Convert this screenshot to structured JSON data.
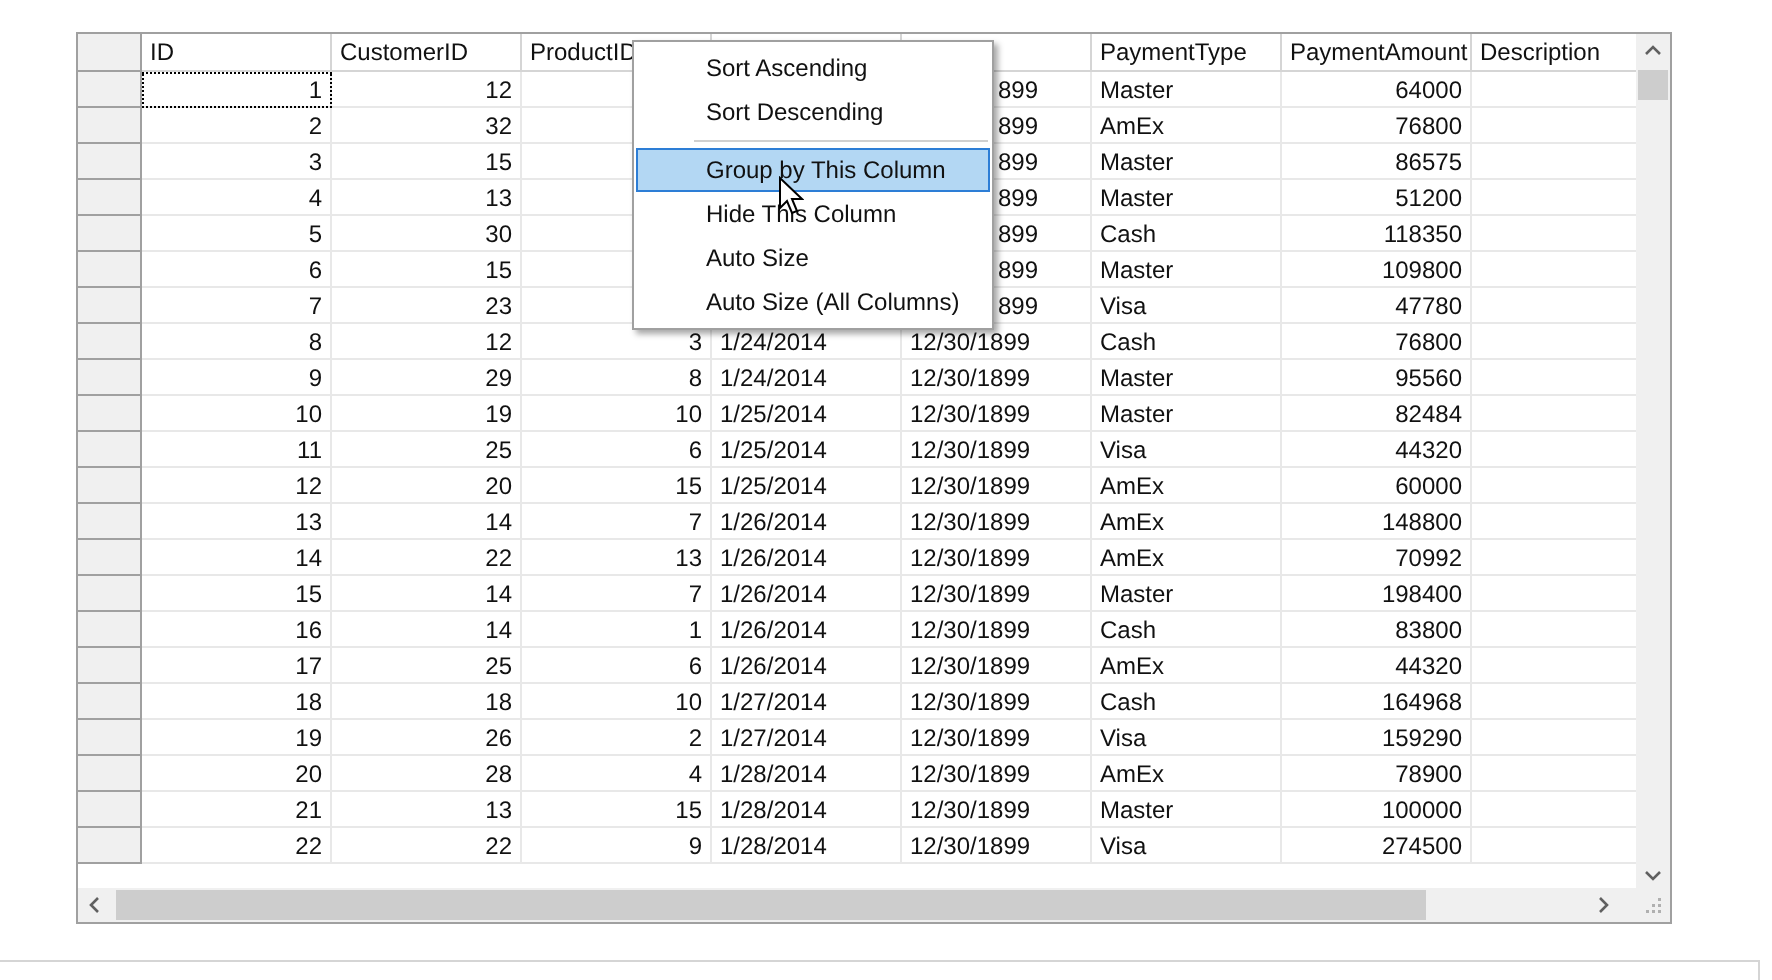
{
  "grid": {
    "columns": [
      {
        "label": "ID"
      },
      {
        "label": "CustomerID"
      },
      {
        "label": "ProductID"
      },
      {},
      {},
      {
        "label": "PaymentType"
      },
      {
        "label": "PaymentAmount"
      },
      {
        "label": "Description"
      }
    ],
    "rows": [
      {
        "focused": true,
        "cells": [
          "1",
          "12",
          null,
          null,
          {
            "kind": "cut",
            "text": "899"
          },
          "Master",
          "64000",
          null
        ]
      },
      {
        "focused": false,
        "cells": [
          "2",
          "32",
          null,
          null,
          {
            "kind": "cut",
            "text": "899"
          },
          "AmEx",
          "76800",
          null
        ]
      },
      {
        "focused": false,
        "cells": [
          "3",
          "15",
          null,
          null,
          {
            "kind": "cut",
            "text": "899"
          },
          "Master",
          "86575",
          null
        ]
      },
      {
        "focused": false,
        "cells": [
          "4",
          "13",
          null,
          null,
          {
            "kind": "cut",
            "text": "899"
          },
          "Master",
          "51200",
          null
        ]
      },
      {
        "focused": false,
        "cells": [
          "5",
          "30",
          null,
          null,
          {
            "kind": "cut",
            "text": "899"
          },
          "Cash",
          "118350",
          null
        ]
      },
      {
        "focused": false,
        "cells": [
          "6",
          "15",
          null,
          null,
          {
            "kind": "cut",
            "text": "899"
          },
          "Master",
          "109800",
          null
        ]
      },
      {
        "focused": false,
        "cells": [
          "7",
          "23",
          null,
          null,
          {
            "kind": "cut",
            "text": "899"
          },
          "Visa",
          "47780",
          null
        ]
      },
      {
        "focused": false,
        "cells": [
          "8",
          "12",
          "3",
          "1/24/2014",
          "12/30/1899",
          "Cash",
          "76800",
          null
        ]
      },
      {
        "focused": false,
        "cells": [
          "9",
          "29",
          "8",
          "1/24/2014",
          "12/30/1899",
          "Master",
          "95560",
          null
        ]
      },
      {
        "focused": false,
        "cells": [
          "10",
          "19",
          "10",
          "1/25/2014",
          "12/30/1899",
          "Master",
          "82484",
          null
        ]
      },
      {
        "focused": false,
        "cells": [
          "11",
          "25",
          "6",
          "1/25/2014",
          "12/30/1899",
          "Visa",
          "44320",
          null
        ]
      },
      {
        "focused": false,
        "cells": [
          "12",
          "20",
          "15",
          "1/25/2014",
          "12/30/1899",
          "AmEx",
          "60000",
          null
        ]
      },
      {
        "focused": false,
        "cells": [
          "13",
          "14",
          "7",
          "1/26/2014",
          "12/30/1899",
          "AmEx",
          "148800",
          null
        ]
      },
      {
        "focused": false,
        "cells": [
          "14",
          "22",
          "13",
          "1/26/2014",
          "12/30/1899",
          "AmEx",
          "70992",
          null
        ]
      },
      {
        "focused": false,
        "cells": [
          "15",
          "14",
          "7",
          "1/26/2014",
          "12/30/1899",
          "Master",
          "198400",
          null
        ]
      },
      {
        "focused": false,
        "cells": [
          "16",
          "14",
          "1",
          "1/26/2014",
          "12/30/1899",
          "Cash",
          "83800",
          null
        ]
      },
      {
        "focused": false,
        "cells": [
          "17",
          "25",
          "6",
          "1/26/2014",
          "12/30/1899",
          "AmEx",
          "44320",
          null
        ]
      },
      {
        "focused": false,
        "cells": [
          "18",
          "18",
          "10",
          "1/27/2014",
          "12/30/1899",
          "Cash",
          "164968",
          null
        ]
      },
      {
        "focused": false,
        "cells": [
          "19",
          "26",
          "2",
          "1/27/2014",
          "12/30/1899",
          "Visa",
          "159290",
          null
        ]
      },
      {
        "focused": false,
        "cells": [
          "20",
          "28",
          "4",
          "1/28/2014",
          "12/30/1899",
          "AmEx",
          "78900",
          null
        ]
      },
      {
        "focused": false,
        "cells": [
          "21",
          "13",
          "15",
          "1/28/2014",
          "12/30/1899",
          "Master",
          "100000",
          null
        ]
      },
      {
        "focused": false,
        "cells": [
          "22",
          "22",
          "9",
          "1/28/2014",
          "12/30/1899",
          "Visa",
          "274500",
          null
        ]
      }
    ]
  },
  "context_menu": {
    "items": [
      {
        "kind": "item",
        "label": "Sort Ascending",
        "selected": false
      },
      {
        "kind": "item",
        "label": "Sort Descending",
        "selected": false
      },
      {
        "kind": "separator"
      },
      {
        "kind": "item",
        "label": "Group by This Column",
        "selected": true
      },
      {
        "kind": "item",
        "label": "Hide This Column",
        "selected": false
      },
      {
        "kind": "item",
        "label": "Auto Size",
        "selected": false
      },
      {
        "kind": "item",
        "label": "Auto Size (All Columns)",
        "selected": false
      }
    ]
  }
}
